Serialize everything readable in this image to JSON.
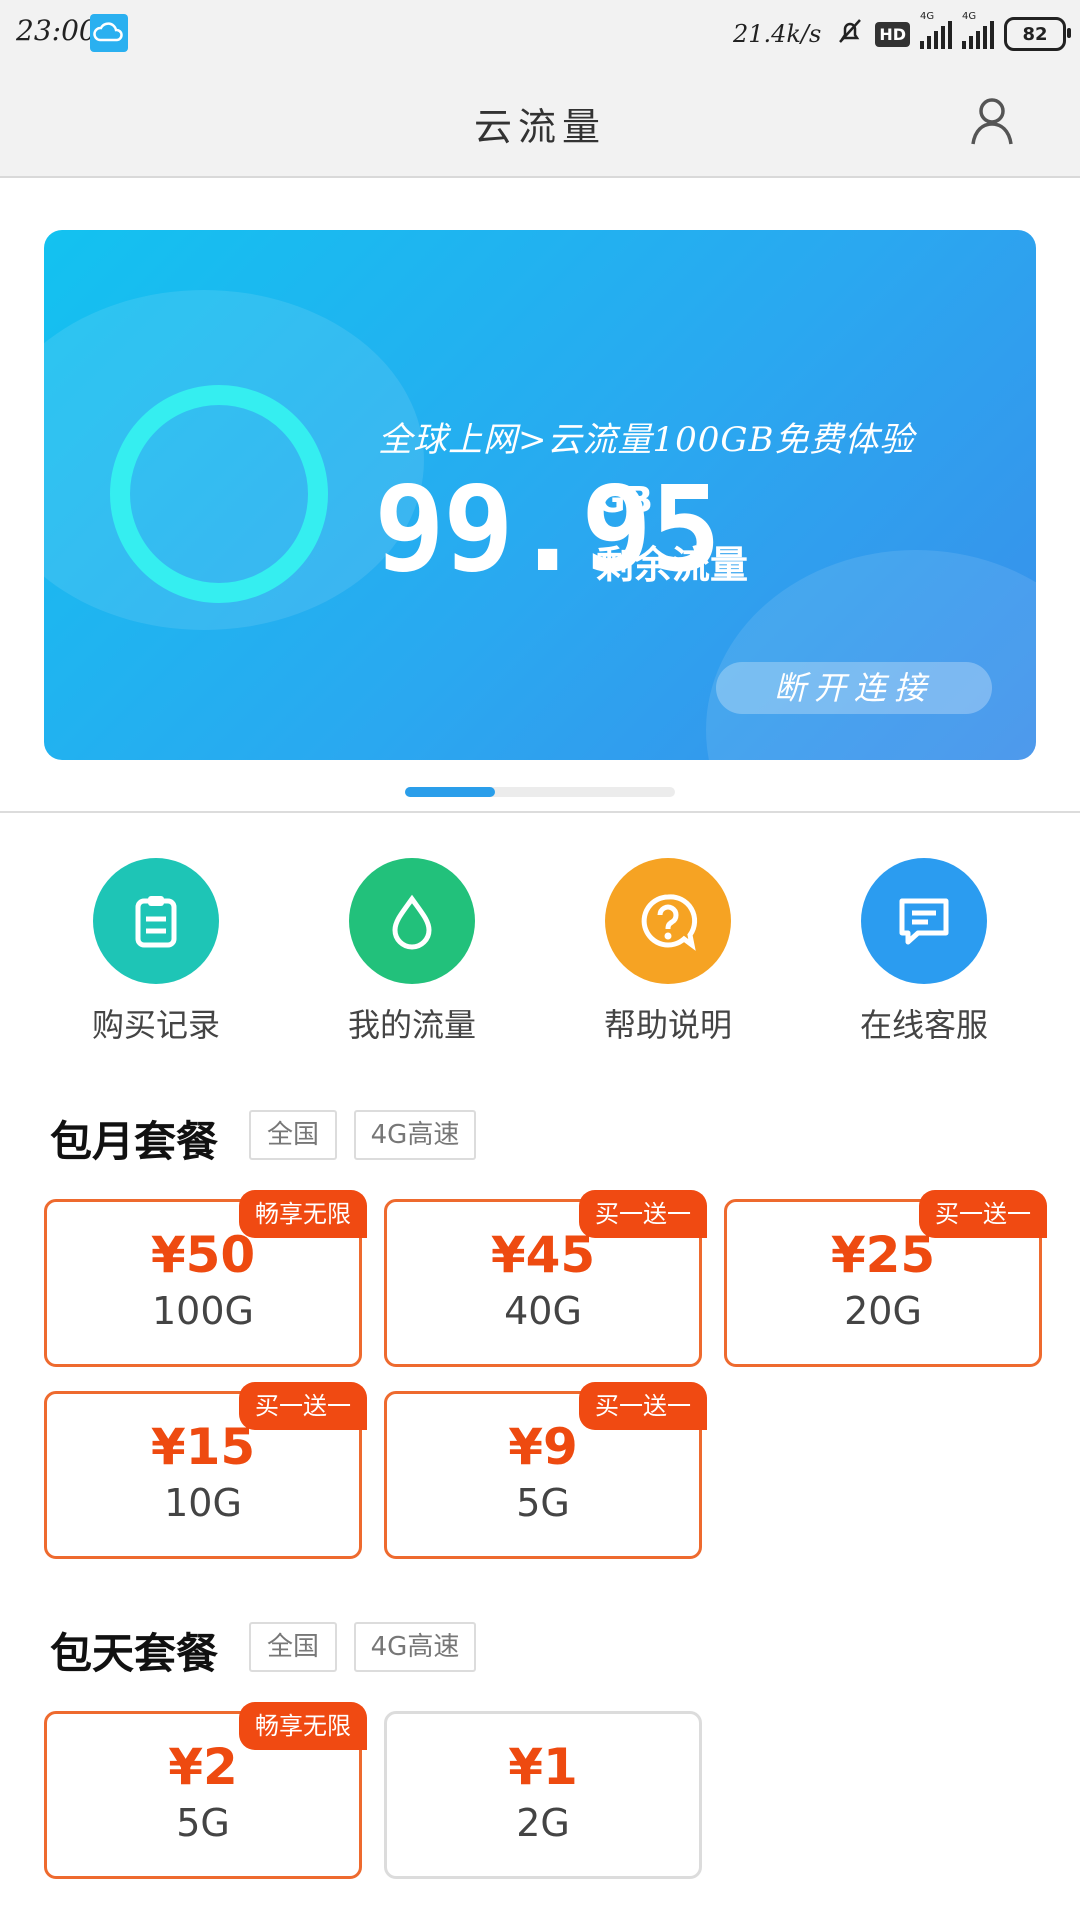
{
  "status_bar": {
    "time": "23:00",
    "speed": "21.4k/s",
    "hd": "HD",
    "network1": "4G",
    "network2": "4G",
    "battery": "82"
  },
  "header": {
    "title": "云流量",
    "user_icon": "user-icon"
  },
  "banner": {
    "subtitle": "全球上网>云流量100GB免费体验",
    "remaining_value": "99.95",
    "remaining_unit": "GB",
    "remaining_label": "剩余流量",
    "disconnect_label": "断开连接",
    "ring_color": "#35eef0"
  },
  "pager": {
    "active_index": 0,
    "count": 3
  },
  "features": [
    {
      "label": "购买记录",
      "icon": "clipboard-icon",
      "color": "#1ec5b6"
    },
    {
      "label": "我的流量",
      "icon": "droplet-icon",
      "color": "#22c17b"
    },
    {
      "label": "帮助说明",
      "icon": "question-icon",
      "color": "#f6a323"
    },
    {
      "label": "在线客服",
      "icon": "chat-icon",
      "color": "#2b9cf0"
    }
  ],
  "monthly": {
    "title": "包月套餐",
    "tags": [
      "全国",
      "4G高速"
    ],
    "packages": [
      {
        "price": "¥50",
        "size": "100G",
        "badge": "畅享无限"
      },
      {
        "price": "¥45",
        "size": "40G",
        "badge": "买一送一"
      },
      {
        "price": "¥25",
        "size": "20G",
        "badge": "买一送一"
      },
      {
        "price": "¥15",
        "size": "10G",
        "badge": "买一送一"
      },
      {
        "price": "¥9",
        "size": "5G",
        "badge": "买一送一"
      }
    ]
  },
  "daily": {
    "title": "包天套餐",
    "tags": [
      "全国",
      "4G高速"
    ],
    "packages": [
      {
        "price": "¥2",
        "size": "5G",
        "badge": "畅享无限"
      },
      {
        "price": "¥1",
        "size": "2G",
        "badge": ""
      }
    ]
  },
  "colors": {
    "accent_orange": "#ee4a10",
    "badge_red": "#f04a12",
    "banner_blue": "#2aa8f0"
  }
}
